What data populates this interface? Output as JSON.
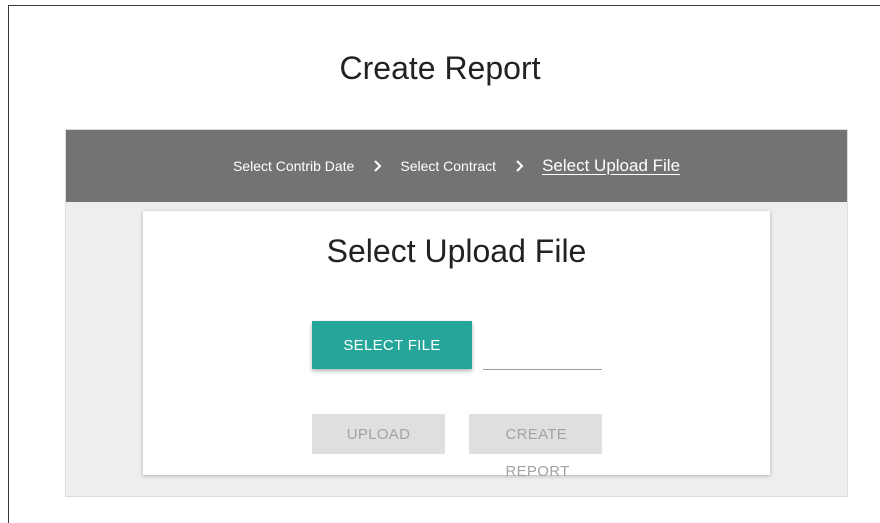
{
  "page": {
    "title": "Create Report"
  },
  "stepper": {
    "steps": [
      {
        "label": "Select Contrib Date"
      },
      {
        "label": "Select Contract"
      },
      {
        "label": "Select Upload File"
      }
    ]
  },
  "card": {
    "title": "Select Upload File",
    "select_file_label": "SELECT FILE",
    "file_name_value": "",
    "upload_label": "UPLOAD",
    "create_report_label": "CREATE REPORT"
  },
  "colors": {
    "accent": "#26a69a",
    "stepper_bg": "#737373",
    "panel_bg": "#eeeeee",
    "disabled_bg": "#dfdfdf",
    "disabled_text": "#a3a3a3"
  },
  "icons": {
    "step_separator": "chevron-right-icon"
  }
}
